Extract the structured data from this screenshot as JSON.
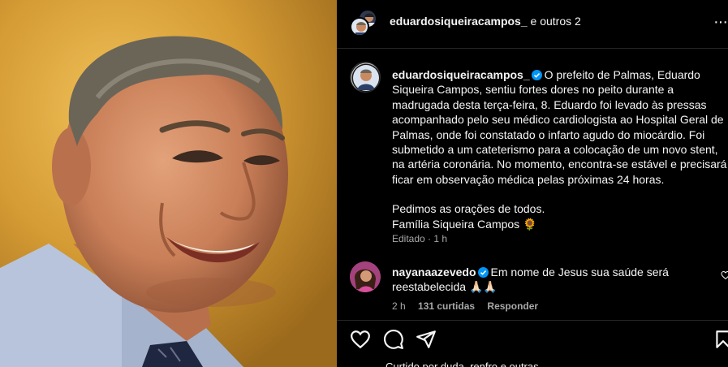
{
  "header": {
    "username": "eduardosiqueiracampos_",
    "collaborators": " e outros 2",
    "more_icon": "more-options-icon"
  },
  "caption": {
    "username": "eduardosiqueiracampos_",
    "verified": true,
    "text": "O prefeito de Palmas, Eduardo Siqueira Campos, sentiu fortes dores no peito durante a madrugada desta terça-feira, 8. Eduardo foi levado às pressas acompanhado pelo seu médico cardiologista ao Hospital Geral de Palmas, onde foi constatado o infarto agudo do miocárdio. Foi submetido a um cateterismo para a colocação de um novo stent, na artéria coronária. No momento, encontra-se estável e precisará ficar em observação médica pelas próximas 24 horas.",
    "closing_line_1": "Pedimos as orações de todos.",
    "closing_line_2": "Família Siqueira Campos 🌻",
    "meta": "Editado · 1 h"
  },
  "comment": {
    "username": "nayanaazevedo",
    "verified": true,
    "text": "Em nome de Jesus sua saúde será reestabelecida 🙏🏻🙏🏻",
    "time": "2 h",
    "likes": "131 curtidas",
    "reply": "Responder"
  },
  "likes_row": "Curtido por duda_renfro e outras",
  "colors": {
    "background": "#000000",
    "text": "#f5f5f5",
    "secondary": "#a8a8a8",
    "verified": "#0095f6",
    "divider": "#262626"
  }
}
